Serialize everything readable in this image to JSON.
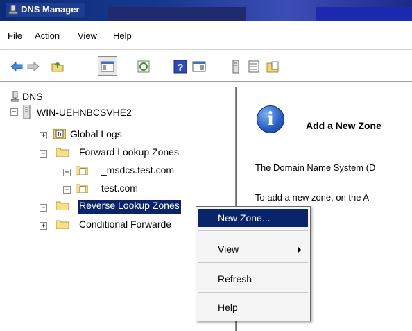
{
  "window": {
    "title": "DNS Manager"
  },
  "menu": {
    "items": [
      "File",
      "Action",
      "View",
      "Help"
    ]
  },
  "toolbar": {
    "buttons": [
      "back-arrow-icon",
      "forward-arrow-icon",
      "up-folder-icon",
      "show-hide-console-tree-icon",
      "refresh-icon",
      "help-icon",
      "show-action-pane-icon",
      "server-icon",
      "list-icon",
      "zone-icon"
    ]
  },
  "tree": {
    "root": "DNS",
    "server": "WIN-UEHNBCSVHE2",
    "global_logs": "Global Logs",
    "forward_zones": "Forward Lookup Zones",
    "zone1": "_msdcs.test.com",
    "zone2": "test.com",
    "reverse_zones": "Reverse Lookup Zones",
    "conditional": "Conditional Forwarde"
  },
  "right": {
    "heading": "Add a New Zone",
    "para1": "The Domain Name System (D",
    "para2": "To add a new zone, on the A"
  },
  "context_menu": {
    "new_zone": "New Zone...",
    "view": "View",
    "refresh": "Refresh",
    "help": "Help"
  },
  "colors": {
    "selection": "#0a246a",
    "title_bar": "#1e3d8f"
  }
}
